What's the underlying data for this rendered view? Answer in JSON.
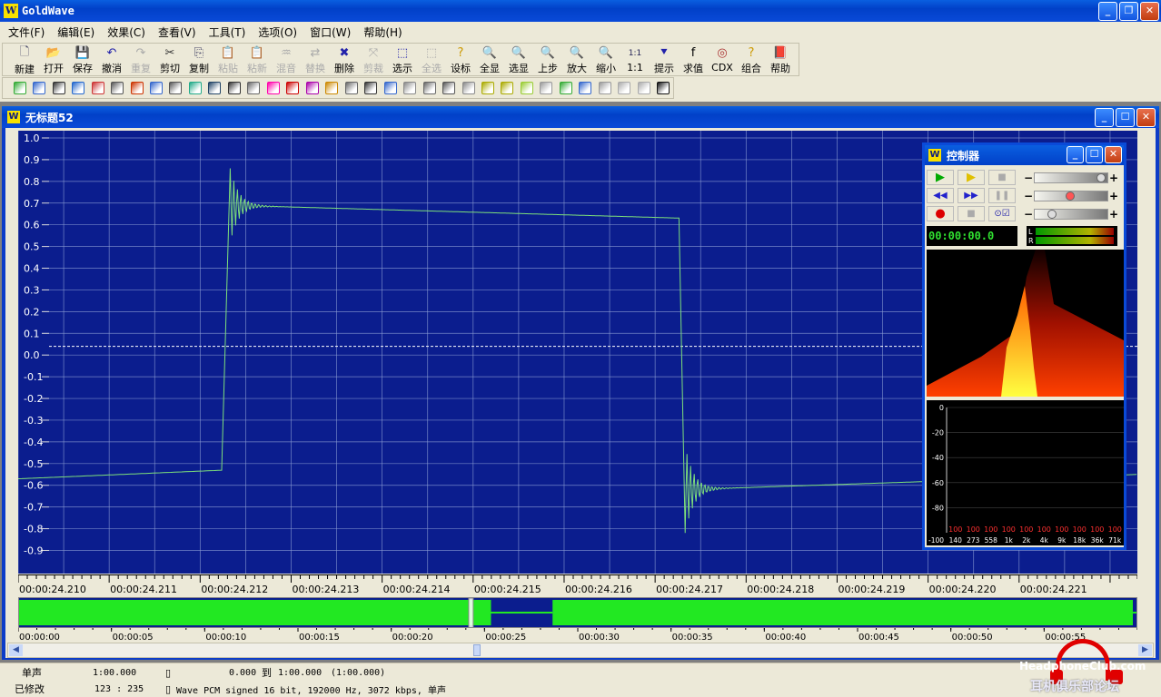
{
  "app": {
    "title": "GoldWave",
    "icon_letter": "W"
  },
  "menu": [
    "文件(F)",
    "编辑(E)",
    "效果(C)",
    "查看(V)",
    "工具(T)",
    "选项(O)",
    "窗口(W)",
    "帮助(H)"
  ],
  "toolbar": [
    {
      "label": "新建",
      "icon": "new-doc-icon",
      "enabled": true
    },
    {
      "label": "打开",
      "icon": "open-folder-icon",
      "enabled": true
    },
    {
      "label": "保存",
      "icon": "save-disk-icon",
      "enabled": true
    },
    {
      "label": "撤消",
      "icon": "undo-icon",
      "enabled": true
    },
    {
      "label": "重复",
      "icon": "redo-icon",
      "enabled": false
    },
    {
      "label": "剪切",
      "icon": "scissors-icon",
      "enabled": true
    },
    {
      "label": "复制",
      "icon": "copy-icon",
      "enabled": true
    },
    {
      "label": "粘贴",
      "icon": "paste-icon",
      "enabled": false
    },
    {
      "label": "粘新",
      "icon": "paste-new-icon",
      "enabled": false
    },
    {
      "label": "混音",
      "icon": "mix-icon",
      "enabled": false
    },
    {
      "label": "替换",
      "icon": "replace-icon",
      "enabled": false
    },
    {
      "label": "删除",
      "icon": "delete-icon",
      "enabled": true
    },
    {
      "label": "剪裁",
      "icon": "trim-icon",
      "enabled": false
    },
    {
      "label": "选示",
      "icon": "select-view-icon",
      "enabled": true
    },
    {
      "label": "全选",
      "icon": "select-all-icon",
      "enabled": false
    },
    {
      "label": "设标",
      "icon": "set-marker-icon",
      "enabled": true
    },
    {
      "label": "全显",
      "icon": "zoom-all-icon",
      "enabled": true
    },
    {
      "label": "选显",
      "icon": "zoom-selection-icon",
      "enabled": true
    },
    {
      "label": "上步",
      "icon": "zoom-previous-icon",
      "enabled": true
    },
    {
      "label": "放大",
      "icon": "zoom-in-icon",
      "enabled": true
    },
    {
      "label": "缩小",
      "icon": "zoom-out-icon",
      "enabled": true
    },
    {
      "label": "1:1",
      "icon": "zoom-1-1-icon",
      "enabled": true
    },
    {
      "label": "提示",
      "icon": "cue-icon",
      "enabled": true
    },
    {
      "label": "求值",
      "icon": "evaluate-icon",
      "enabled": true
    },
    {
      "label": "CDX",
      "icon": "cd-icon",
      "enabled": true
    },
    {
      "label": "组合",
      "icon": "batch-icon",
      "enabled": true
    },
    {
      "label": "帮助",
      "icon": "help-book-icon",
      "enabled": true
    }
  ],
  "toolbar2_icons": [
    "#3a3",
    "#36c",
    "#333",
    "#26c",
    "#c33",
    "#555",
    "#c30",
    "#36c",
    "#555",
    "#2a8",
    "#246",
    "#333",
    "#666",
    "#f0a",
    "#c00",
    "#a0a",
    "#c80",
    "#666",
    "#333",
    "#36c",
    "#888",
    "#666",
    "#555",
    "#888",
    "#aa0",
    "#aa0",
    "#9c3",
    "#999",
    "#3a3",
    "#36c",
    "#999",
    "#aaa",
    "#aaa",
    "#111"
  ],
  "document": {
    "title": "无标题52",
    "icon_letter": "W"
  },
  "waveform": {
    "y_ticks": [
      "1.0",
      "0.9",
      "0.8",
      "0.7",
      "0.6",
      "0.5",
      "0.4",
      "0.3",
      "0.2",
      "0.1",
      "0.0",
      "-0.1",
      "-0.2",
      "-0.3",
      "-0.4",
      "-0.5",
      "-0.6",
      "-0.7",
      "-0.8",
      "-0.9"
    ],
    "time_ticks": [
      "00:00:24.210",
      "00:00:24.211",
      "00:00:24.212",
      "00:00:24.213",
      "00:00:24.214",
      "00:00:24.215",
      "00:00:24.216",
      "00:00:24.217",
      "00:00:24.218",
      "00:00:24.219",
      "00:00:24.220",
      "00:00:24.221"
    ],
    "time_range_ms": [
      24210,
      24222.3
    ],
    "signal": {
      "low_start": -0.57,
      "low_end_before_rise": -0.53,
      "rise_at_ms": 24212.33,
      "overshoot_peak": 0.86,
      "high_start": 0.69,
      "high_end": 0.63,
      "fall_at_ms": 24217.33,
      "undershoot_min": -0.82,
      "low_settle": -0.62,
      "low_final": -0.55
    },
    "colors": {
      "background": "#0b1d8e",
      "grid": "#8fa0d6",
      "wave": "#7ee07a",
      "zero_line": "#ffffff"
    }
  },
  "overview": {
    "time_ticks": [
      "00:00:00",
      "00:00:05",
      "00:00:10",
      "00:00:15",
      "00:00:20",
      "00:00:25",
      "00:00:30",
      "00:00:35",
      "00:00:40",
      "00:00:45",
      "00:00:50",
      "00:00:55"
    ],
    "total_s": 60,
    "silence_s": [
      25.3,
      28.6
    ],
    "cursor_s": 24.2,
    "colors": {
      "wave": "#22e822",
      "background": "#0b1d8e"
    }
  },
  "controller": {
    "title": "控制器",
    "clock": "00:00:00.0",
    "lr": [
      "L",
      "R"
    ],
    "eq_y_labels": [
      "0",
      "-20",
      "-40",
      "-60",
      "-80",
      "-100"
    ],
    "eq_freq_labels": [
      "140",
      "273",
      "558",
      "1k",
      "2k",
      "4k",
      "9k",
      "18k",
      "36k",
      "71k"
    ],
    "eq_values": [
      "100",
      "100",
      "100",
      "100",
      "100",
      "100",
      "100",
      "100",
      "100",
      "100"
    ]
  },
  "status": {
    "channels": "单声",
    "length": "1:00.000",
    "selection_start": "0.000",
    "to": "到",
    "selection_end": "1:00.000",
    "selection_len": "(1:00.000)",
    "modified": "已修改",
    "position": "123 : 235",
    "format": "Wave PCM signed 16 bit, 192000 Hz, 3072 kbps, 单声"
  },
  "watermark": {
    "line1": "HeadphoneClub.com",
    "line2": "耳机俱乐部论坛"
  }
}
